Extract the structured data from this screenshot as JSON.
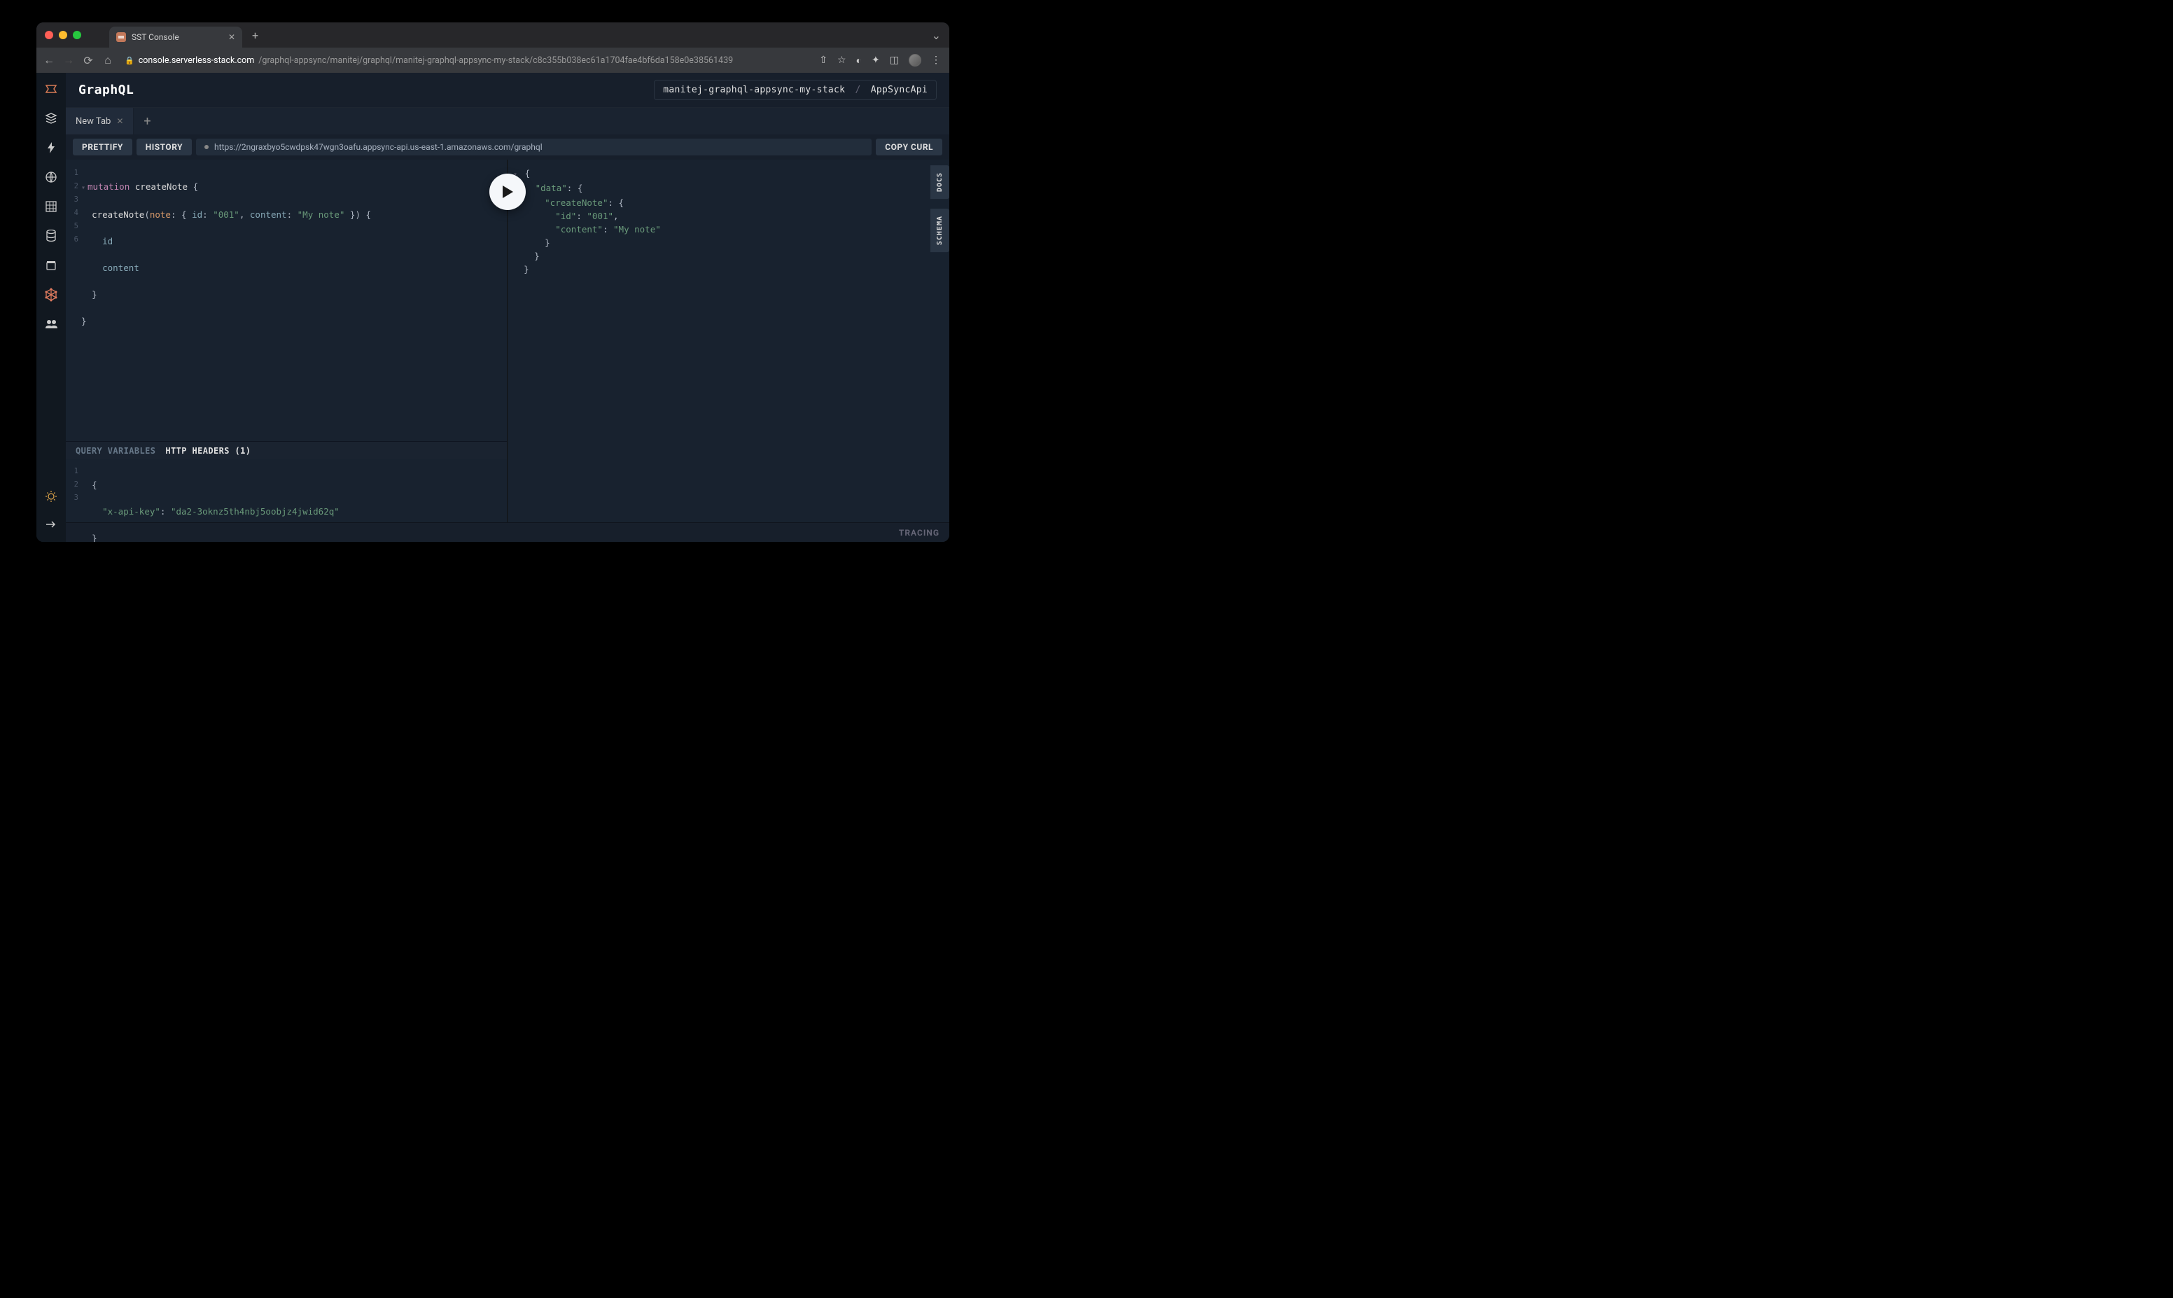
{
  "browser": {
    "tab_title": "SST Console",
    "url_host": "console.serverless-stack.com",
    "url_path": "/graphql-appsync/manitej/graphql/manitej-graphql-appsync-my-stack/c8c355b038ec61a1704fae4bf6da158e0e38561439"
  },
  "header": {
    "title": "GraphQL",
    "breadcrumb_stack": "manitej-graphql-appsync-my-stack",
    "breadcrumb_api": "AppSyncApi"
  },
  "subtab": {
    "label": "New Tab"
  },
  "toolbar": {
    "prettify": "PRETTIFY",
    "history": "HISTORY",
    "endpoint": "https://2ngraxbyo5cwdpsk47wgn3oafu.appsync-api.us-east-1.amazonaws.com/graphql",
    "copy_curl": "COPY CURL"
  },
  "query": {
    "line1_kw": "mutation",
    "line1_name": "createNote",
    "line2_fn": "createNote",
    "line2_argname": "note",
    "line2_id_key": "id",
    "line2_id_val": "\"001\"",
    "line2_content_key": "content",
    "line2_content_val": "\"My note\"",
    "line3": "id",
    "line4": "content",
    "gutter": [
      "1",
      "2",
      "3",
      "4",
      "5",
      "6"
    ]
  },
  "response": {
    "data_key": "\"data\"",
    "createNote_key": "\"createNote\"",
    "id_key": "\"id\"",
    "id_val": "\"001\"",
    "content_key": "\"content\"",
    "content_val": "\"My note\""
  },
  "bottom": {
    "query_vars": "QUERY VARIABLES",
    "http_headers": "HTTP HEADERS (1)",
    "gutter": [
      "1",
      "2",
      "3"
    ],
    "api_key_label": "\"x-api-key\"",
    "api_key_value": "\"da2-3oknz5th4nbj5oobjz4jwid62q\""
  },
  "side": {
    "docs": "DOCS",
    "schema": "SCHEMA"
  },
  "footer": {
    "tracing": "TRACING"
  }
}
